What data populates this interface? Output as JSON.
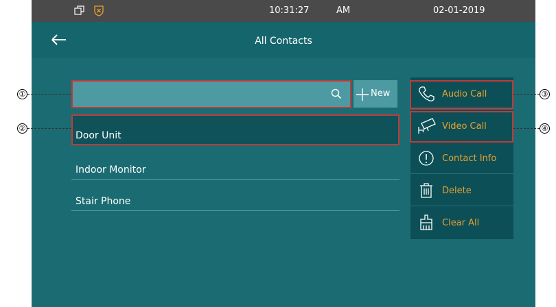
{
  "status": {
    "time": "10:31:27",
    "ampm": "AM",
    "date": "02-01-2019"
  },
  "header": {
    "title": "All Contacts"
  },
  "search": {
    "value": "",
    "placeholder": ""
  },
  "new_button": {
    "label": "New"
  },
  "contacts": [
    {
      "name": "Door Unit",
      "selected": true
    },
    {
      "name": "Indoor Monitor",
      "selected": false
    },
    {
      "name": "Stair Phone",
      "selected": false
    }
  ],
  "actions": [
    {
      "label": "Audio Call",
      "icon": "phone-icon"
    },
    {
      "label": "Video Call",
      "icon": "camera-icon"
    },
    {
      "label": "Contact Info",
      "icon": "info-icon"
    },
    {
      "label": "Delete",
      "icon": "trash-icon"
    },
    {
      "label": "Clear All",
      "icon": "broom-icon"
    }
  ],
  "callouts": [
    "①",
    "②",
    "③",
    "④"
  ],
  "colors": {
    "screen": "#1a6c72",
    "statusbar": "#4a4a4a",
    "accent": "#e8a030",
    "highlight": "#c23a3a"
  }
}
